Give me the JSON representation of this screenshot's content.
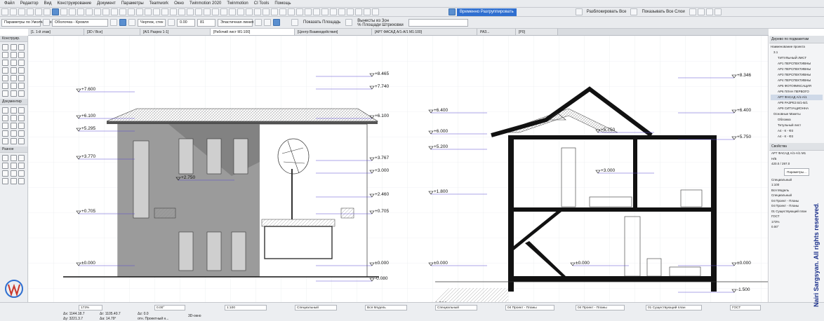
{
  "menu": [
    "Файл",
    "Редактор",
    "Вид",
    "Конструирование",
    "Документ",
    "Параметры",
    "Teamwork",
    "Окно",
    "Twinmotion 2020",
    "Twinmotion",
    "CI Tools",
    "Помощь"
  ],
  "toolbar1": {
    "temp_group": "Временно Разгруппировать",
    "ungroup_all": "Разблокировать Все",
    "show_all_layers": "Показывать Все Слои"
  },
  "toolbar2": {
    "info_label": "Параметры по Умолчанию",
    "layer": "Оболочка - Кровля",
    "pen_field": "Чертеж, стек",
    "val1": "0.00",
    "val2": "81",
    "show_area": "Показать Площадь",
    "take_from_zone": "Вынесты из Зон",
    "area_note": "% Площади Штриховки",
    "pen_label": "Эластичная линия"
  },
  "tabs": [
    {
      "label": "[1. 1-й этаж]",
      "active": false
    },
    {
      "label": "[3D / Все]",
      "active": false
    },
    {
      "label": "[А/1 Разрез 1-1]",
      "active": false
    },
    {
      "label": "[Рабочий лист М1:100]",
      "active": true
    },
    {
      "label": "[Центр Взаимодействия]",
      "active": false
    },
    {
      "label": "[АР7 ФАСАД А/1-А/1 М1:100]",
      "active": false
    },
    {
      "label": "РАЗ...",
      "active": false
    },
    {
      "label": "[Р0]",
      "active": false
    }
  ],
  "left_sections": [
    "Конструир.",
    "Документир",
    "Разное"
  ],
  "left_labels": {
    "a1": "А1",
    "text_a": "A"
  },
  "elevation": {
    "levels": [
      "+8.465",
      "+7.740",
      "+7.600",
      "+6.100",
      "+6.100",
      "+5.295",
      "+3.770",
      "+3.767",
      "+3.000",
      "+2.750",
      "+2.460",
      "+0.705",
      "+0.705",
      "±0.000",
      "±0.000",
      "-0.080"
    ]
  },
  "section": {
    "levels": [
      "+8.346",
      "+6.400",
      "+6.400",
      "+6.000",
      "+5.750",
      "+5.750",
      "+5.200",
      "+3.000",
      "+1.800",
      "±0.000",
      "±0.000",
      "±0.000",
      "-1.500",
      "-1.500"
    ]
  },
  "right_panel": {
    "navigator_title": "Дерево по подмакетам",
    "project_name": "Наименование проекта",
    "tree": [
      "3.1",
      "ТИТУЛЬНЫЙ ЛИСТ",
      "АР1 ПЕРСПЕКТИВНЫ",
      "АР2 ПЕРСПЕКТИВНЫ",
      "АР3 ПЕРСПЕКТИВНЫ",
      "АР4 ПЕРСПЕКТИВНЫ",
      "АР5 ФОТОФИКСАЦИЯ",
      "АР6 ПЛАН ПЕРВОГО",
      "АР7 ФАСАД А/1-А/1",
      "АР8 РАЗРЕЗ Б/1-Б/1",
      "АР9 СИТУАЦИОННА",
      "Основные Макеты",
      "Обложка",
      "Титульный лист",
      "А4 - К - Ф3",
      "А4 - К - Ф3"
    ],
    "selected_tree": "АР7 ФАСАД А/1-А/1",
    "props_title": "Свойства",
    "prop_id": "АР7",
    "prop_name": "ФАСАД А/1-А/1 М1",
    "prop_num": "Н/Б",
    "prop_size": "420.0 / 297.0",
    "params_btn": "Параметры...",
    "props": [
      "Специальный",
      "1:100",
      "Вся Модель",
      "Специальный",
      "04 Проект - Планы",
      "04 Проект - Планы",
      "01 Существующий план",
      "ГОСТ",
      "173%",
      "0.00°"
    ]
  },
  "status": {
    "zoom": "173%",
    "angle": "0.00°",
    "scale": "1:100",
    "layer_combo": "Специальный",
    "model": "Вся Модель",
    "special2": "Специальный",
    "pen_set": "04 Проект - Планы",
    "mvo": "04 Проект - Планы",
    "renovation": "01 Существующий план",
    "dim": "ГОСТ",
    "coord_x": "Δx: 1144.18.7",
    "coord_y": "Δy: 3221.3.7",
    "coord_d": "Δr: 1105.40.7",
    "coord_a": "Δa: 14.79°",
    "coord_z": "Δz: 0.0",
    "ref": "отн. Проектный н...",
    "view3d": "3D-окно"
  },
  "watermark": "Nairi Sargsyan. All rights reserved."
}
